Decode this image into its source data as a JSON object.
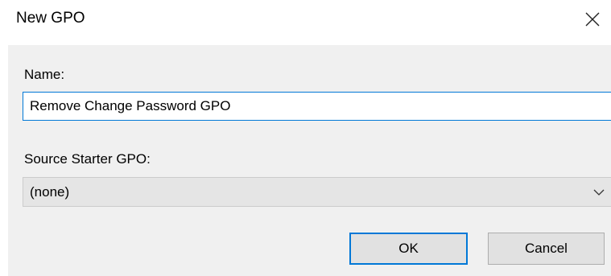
{
  "window": {
    "title": "New GPO",
    "close_icon": "close-icon"
  },
  "form": {
    "name_label": "Name:",
    "name_value": "Remove Change Password GPO",
    "source_label": "Source Starter GPO:",
    "source_value": "(none)",
    "dropdown_icon": "chevron-down-icon"
  },
  "buttons": {
    "ok_label": "OK",
    "cancel_label": "Cancel"
  },
  "colors": {
    "accent": "#0078d7",
    "panel_background": "#f0f0f0",
    "button_background": "#e1e1e1"
  }
}
